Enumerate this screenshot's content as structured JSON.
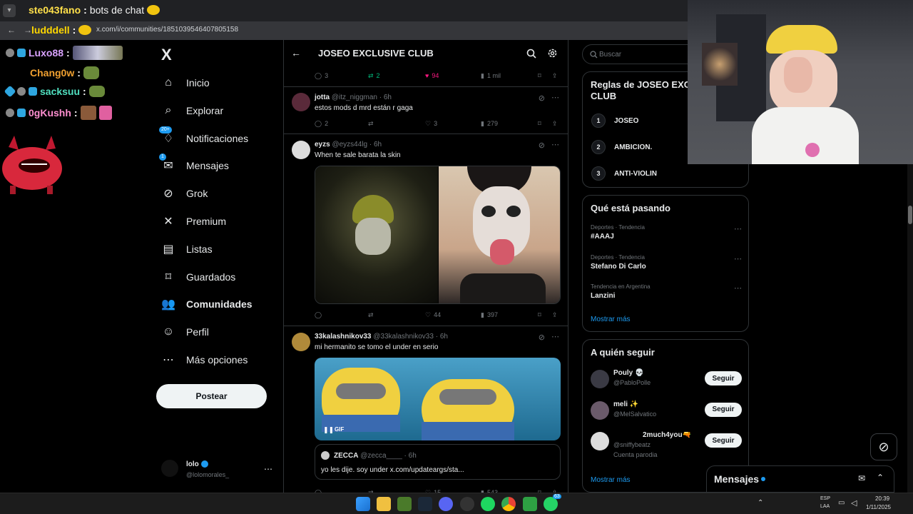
{
  "browser": {
    "url": "x.com/i/communities/1851039546407805158"
  },
  "chat": {
    "lines": [
      {
        "user": "ste043fano",
        "message": "bots de chat"
      },
      {
        "user": "ludddell",
        "message": ""
      },
      {
        "user": "Luxo88",
        "message": ""
      },
      {
        "user": "Chang0w",
        "message": ""
      },
      {
        "user": "sacksuu",
        "message": ""
      },
      {
        "user": "0gKushh",
        "message": ""
      }
    ]
  },
  "sidebar": {
    "logo": "X",
    "items": [
      {
        "label": "Inicio",
        "icon": "home-icon"
      },
      {
        "label": "Explorar",
        "icon": "search-icon"
      },
      {
        "label": "Notificaciones",
        "icon": "bell-icon",
        "badge": "20+"
      },
      {
        "label": "Mensajes",
        "icon": "mail-icon",
        "badge": "1"
      },
      {
        "label": "Grok",
        "icon": "grok-icon"
      },
      {
        "label": "Premium",
        "icon": "x-icon"
      },
      {
        "label": "Listas",
        "icon": "list-icon"
      },
      {
        "label": "Guardados",
        "icon": "bookmark-icon"
      },
      {
        "label": "Comunidades",
        "icon": "people-icon"
      },
      {
        "label": "Perfil",
        "icon": "person-icon"
      },
      {
        "label": "Más opciones",
        "icon": "more-icon"
      }
    ],
    "post_label": "Postear",
    "account": {
      "name": "lolo",
      "handle": "@lolomorales_"
    }
  },
  "main": {
    "title": "JOSEO EXCLUSIVE CLUB",
    "top_actions": {
      "replies": "3",
      "reposts": "2",
      "likes": "94",
      "views": "1 mil"
    },
    "tweets": [
      {
        "name": "jotta",
        "handle": "@itz_niggman",
        "time": "6h",
        "text": "estos mods d mrd están r gaga",
        "replies": "2",
        "reposts": "",
        "likes": "3",
        "views": "279"
      },
      {
        "name": "eyzs",
        "handle": "@eyzs44lg",
        "time": "6h",
        "text": "When te  sale barata la skin",
        "replies": "",
        "reposts": "",
        "likes": "44",
        "views": "397"
      },
      {
        "name": "33kalashnikov33",
        "handle": "@33kalashnikov33",
        "time": "6h",
        "text": "mi hermanito se tomo el under en serio",
        "gif_label": "GIF",
        "quote": {
          "name": "ZECCA",
          "handle": "@zecca____",
          "time": "6h",
          "text": "yo les dije. soy under x.com/updateargs/sta..."
        },
        "likes": "15",
        "views": "543"
      }
    ]
  },
  "right": {
    "search_placeholder": "Buscar",
    "rules_title": "Reglas de JOSEO EXCLUSIVE CLUB",
    "rules": [
      {
        "num": "1",
        "label": "JOSEO"
      },
      {
        "num": "2",
        "label": "AMBICION."
      },
      {
        "num": "3",
        "label": "ANTI-VIOLIN"
      }
    ],
    "trends_title": "Qué está pasando",
    "trends": [
      {
        "category": "Deportes · Tendencia",
        "name": "#AAAJ"
      },
      {
        "category": "Deportes · Tendencia",
        "name": "Stefano Di Carlo"
      },
      {
        "category": "Tendencia en Argentina",
        "name": "Lanzini"
      }
    ],
    "trends_more": "Mostrar más",
    "follow_title": "A quién seguir",
    "follow": [
      {
        "name": "Pouly 💀",
        "handle": "@PabloPolle",
        "button": "Seguir"
      },
      {
        "name": "meli ✨",
        "handle": "@MelSalvatico",
        "button": "Seguir"
      },
      {
        "name": "2much4you🔫",
        "handle": "@sniffybeatz",
        "button": "Seguir",
        "note": "Cuenta parodia"
      }
    ],
    "follow_more": "Mostrar más",
    "messages_label": "Mensajes"
  },
  "taskbar": {
    "lang": "ESP",
    "lang2": "LAA",
    "time": "20:39",
    "date": "1/11/2025",
    "whatsapp_badge": "63"
  },
  "colors": {
    "accent": "#1d9bf0",
    "like": "#f91880",
    "repost": "#00ba7c",
    "chat_user": "#ffcf40"
  }
}
